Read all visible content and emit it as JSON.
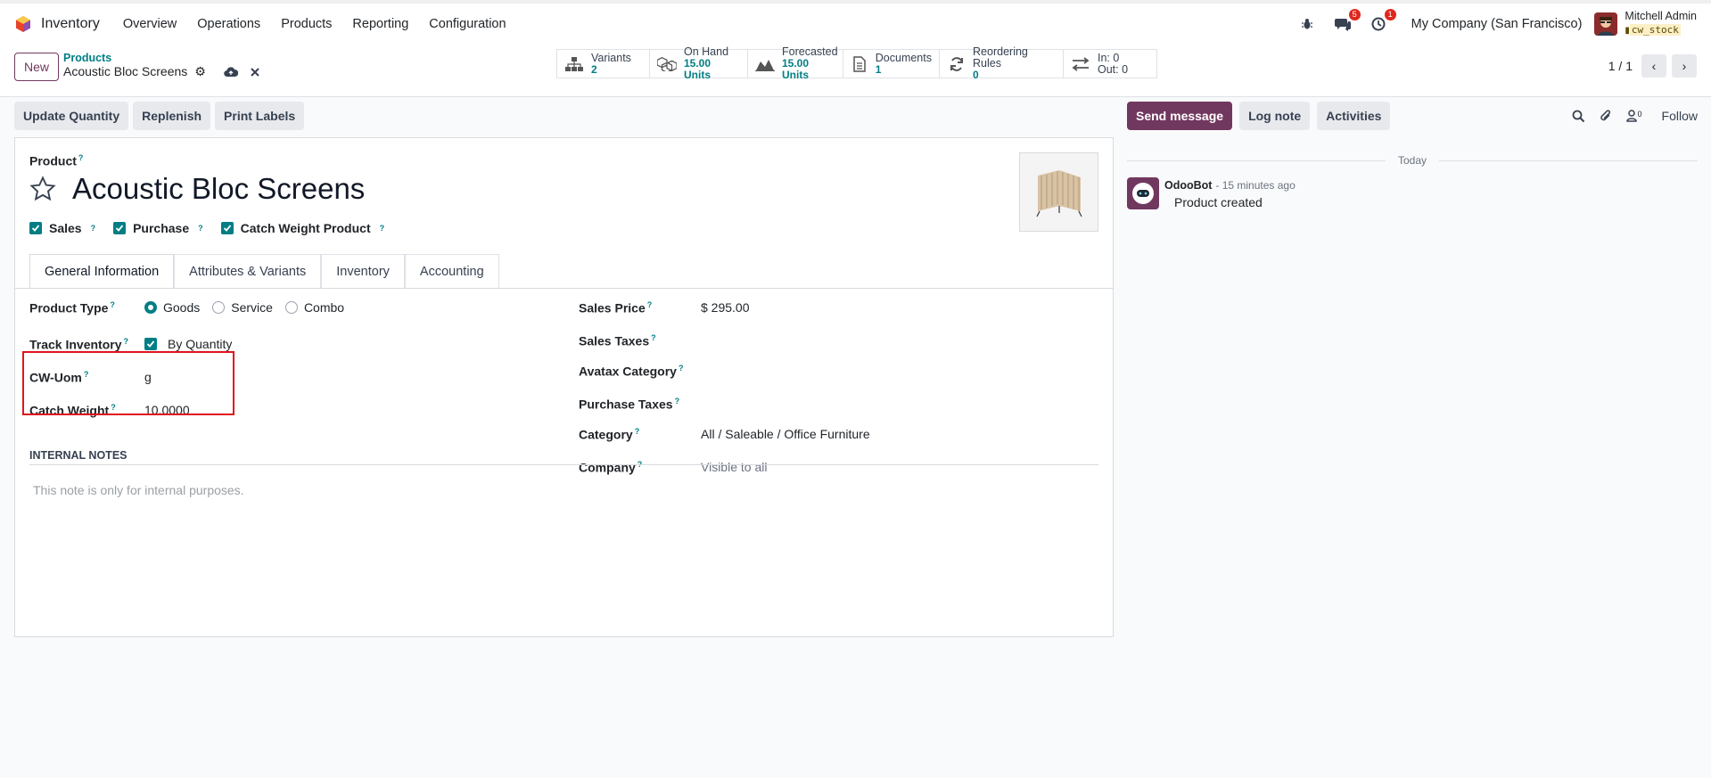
{
  "navbar": {
    "app_name": "Inventory",
    "menu": [
      "Overview",
      "Operations",
      "Products",
      "Reporting",
      "Configuration"
    ],
    "messages_badge": "5",
    "activities_badge": "1",
    "company": "My Company (San Francisco)",
    "user_name": "Mitchell Admin",
    "db_name": "cw_stock"
  },
  "control_panel": {
    "new_label": "New",
    "breadcrumb_parent": "Products",
    "breadcrumb_current": "Acoustic Bloc Screens",
    "pager": "1 / 1",
    "smart_buttons": [
      {
        "icon": "sitemap-icon",
        "label": "Variants",
        "value": "2"
      },
      {
        "icon": "cubes-icon",
        "label": "On Hand",
        "value": "15.00 Units"
      },
      {
        "icon": "area-chart-icon",
        "label": "Forecasted",
        "value": "15.00 Units"
      },
      {
        "icon": "document-icon",
        "label": "Documents",
        "value": "1"
      },
      {
        "icon": "refresh-icon",
        "label": "Reordering Rules",
        "value": "0"
      },
      {
        "icon": "exchange-icon",
        "label": "In: 0",
        "value": "Out: 0"
      }
    ]
  },
  "actions": {
    "update_quantity": "Update Quantity",
    "replenish": "Replenish",
    "print_labels": "Print Labels"
  },
  "form": {
    "product_label": "Product",
    "q": "?",
    "name": "Acoustic Bloc Screens",
    "checks": {
      "sales": "Sales",
      "purchase": "Purchase",
      "catch_weight": "Catch Weight Product"
    },
    "tabs": [
      "General Information",
      "Attributes & Variants",
      "Inventory",
      "Accounting"
    ],
    "left_fields": {
      "product_type_label": "Product Type",
      "type_options": [
        "Goods",
        "Service",
        "Combo"
      ],
      "track_inventory_label": "Track Inventory",
      "track_inventory_value": "By Quantity",
      "cw_uom_label": "CW-Uom",
      "cw_uom_value": "g",
      "catch_weight_label": "Catch Weight",
      "catch_weight_value": "10.0000"
    },
    "right_fields": {
      "sales_price_label": "Sales Price",
      "sales_price_value": "$ 295.00",
      "sales_taxes_label": "Sales Taxes",
      "avatax_label": "Avatax Category",
      "purchase_taxes_label": "Purchase Taxes",
      "category_label": "Category",
      "category_value": "All / Saleable / Office Furniture",
      "company_label": "Company",
      "company_placeholder": "Visible to all"
    },
    "notes_header": "INTERNAL NOTES",
    "notes_placeholder": "This note is only for internal purposes."
  },
  "chatter": {
    "send_message": "Send message",
    "log_note": "Log note",
    "activities": "Activities",
    "followers_count": "0",
    "follow": "Follow",
    "date_separator": "Today",
    "message_author": "OdooBot",
    "message_time": "- 15 minutes ago",
    "message_body": "Product created"
  },
  "colors": {
    "primary": "#71385f",
    "accent": "#017e84",
    "highlight": "#e0141e"
  }
}
